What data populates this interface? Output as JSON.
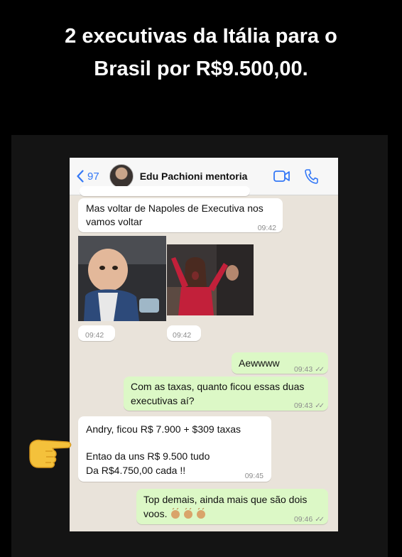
{
  "headline": {
    "line1": "2 executivas da Itália para o",
    "line2": "Brasil por R$9.500,00."
  },
  "chat_header": {
    "back_count": "97",
    "contact_name": "Edu Pachioni mentoria"
  },
  "messages": [
    {
      "dir": "in",
      "lines": [
        "Mas voltar de Napoles de Executiva nos",
        "vamos voltar"
      ],
      "time": "09:42"
    },
    {
      "dir": "in",
      "type": "image",
      "description_icon": "photo-baby-icon",
      "time": "09:42"
    },
    {
      "dir": "in",
      "type": "image",
      "description_icon": "photo-celebrating-girl-icon",
      "time": "09:42"
    },
    {
      "dir": "out",
      "lines": [
        "Aewwww"
      ],
      "time": "09:43"
    },
    {
      "dir": "out",
      "lines": [
        "Com as taxas, quanto ficou essas duas",
        "executivas aí?"
      ],
      "time": "09:43"
    },
    {
      "dir": "in",
      "lines": [
        "Andry, ficou R$ 7.900 + $309 taxas",
        "",
        "Entao da uns R$ 9.500 tudo",
        "Da R$4.750,00 cada !!"
      ],
      "time": "09:45"
    },
    {
      "dir": "out",
      "lines": [
        "Top demais, ainda mais que são dois",
        "voos. "
      ],
      "time": "09:46"
    }
  ],
  "colors": {
    "background": "#000000",
    "outgoing_bubble": "#dcf8c6",
    "incoming_bubble": "#ffffff",
    "accent": "#3478f6"
  }
}
